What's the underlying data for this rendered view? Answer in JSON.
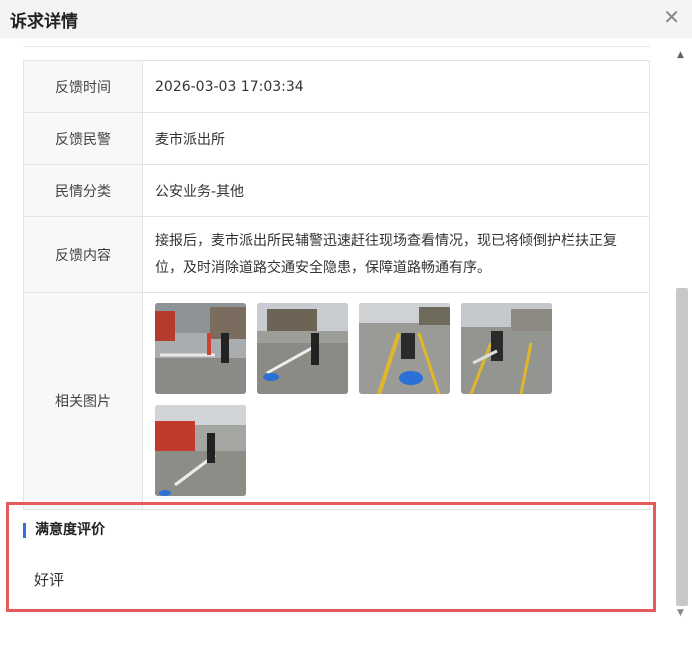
{
  "dialog": {
    "title": "诉求详情",
    "close_glyph": "✕"
  },
  "rows": [
    {
      "label": "反馈时间",
      "value": "2026-03-03 17:03:34"
    },
    {
      "label": "反馈民警",
      "value": "麦市派出所"
    },
    {
      "label": "民情分类",
      "value": "公安业务-其他"
    },
    {
      "label": "反馈内容",
      "value": "接报后，麦市派出所民辅警迅速赶往现场查看情况，现已将倾倒护栏扶正复位，及时消除道路交通安全隐患，保障道路畅通有序。"
    }
  ],
  "images": {
    "label": "相关图片",
    "count": 5
  },
  "satisfaction": {
    "title": "满意度评价",
    "value": "好评"
  },
  "scrollbar": {
    "up": "▲",
    "down": "▼"
  }
}
